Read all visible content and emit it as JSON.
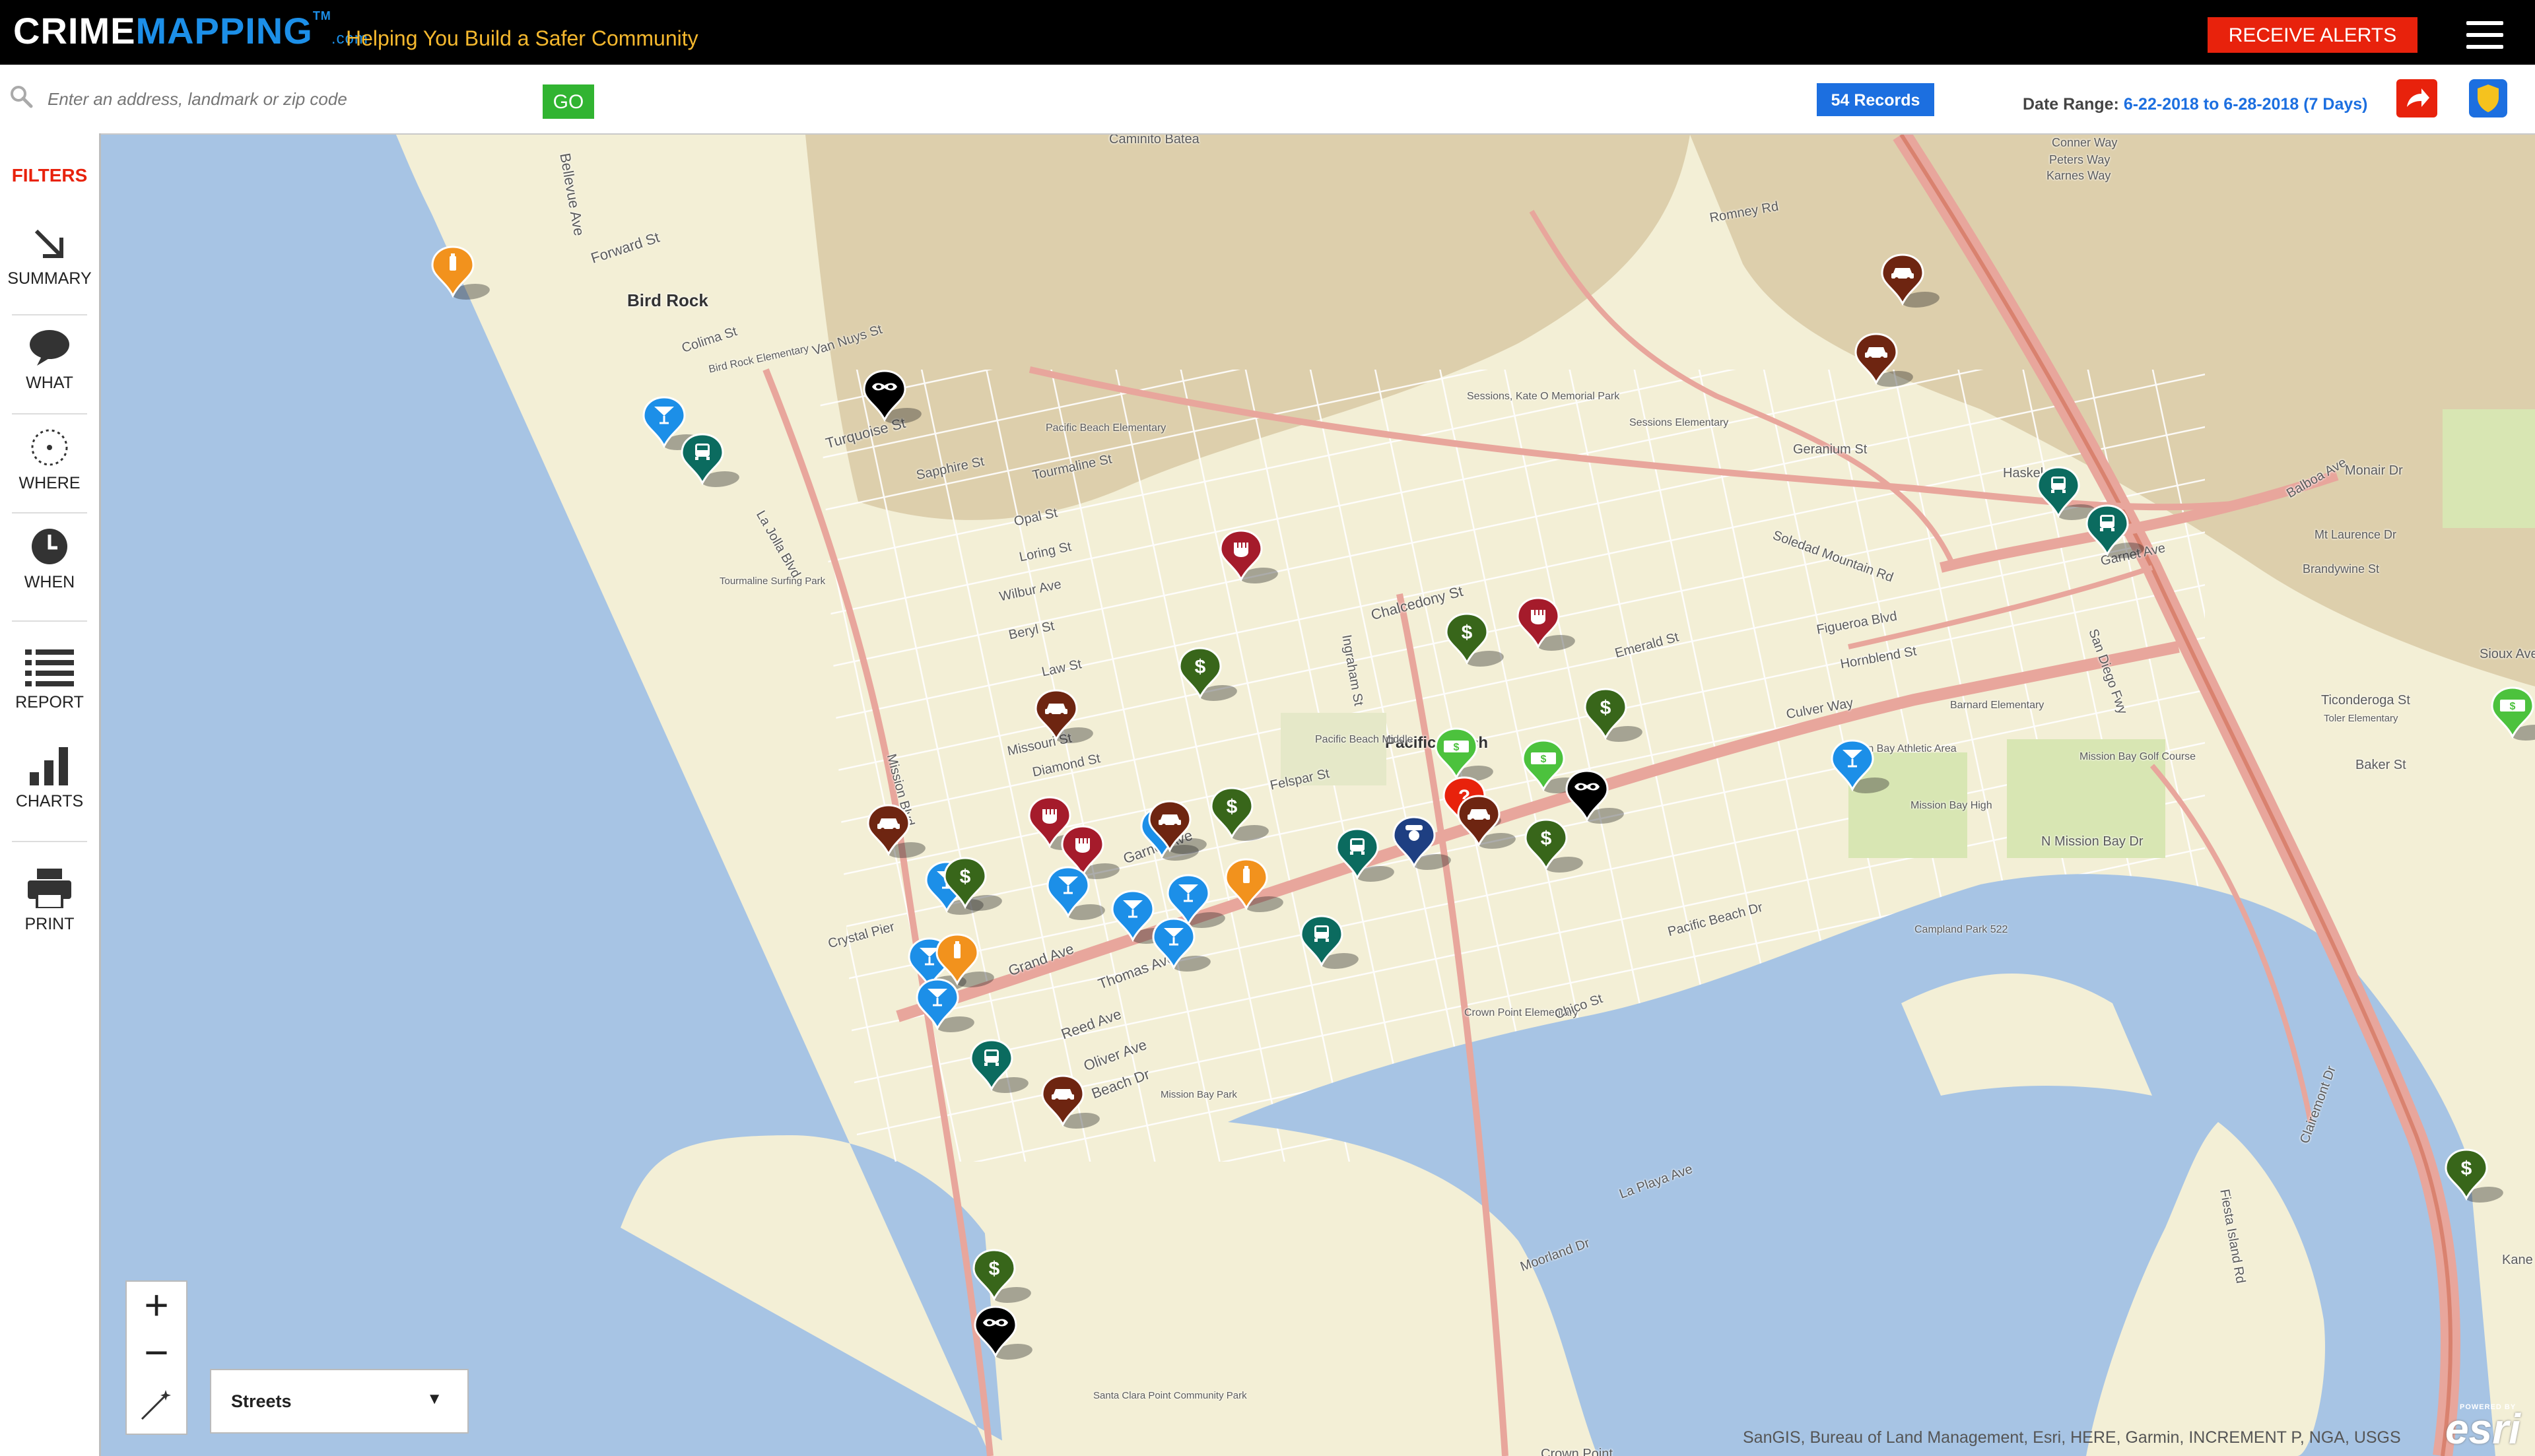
{
  "header": {
    "logo_crime": "CRIME",
    "logo_mapping": "MAPPING",
    "logo_tm": "TM",
    "logo_com": ".com",
    "tagline": "Helping You Build a Safer Community",
    "alerts_label": "RECEIVE ALERTS"
  },
  "search": {
    "placeholder": "Enter an address, landmark or zip code",
    "go_label": "GO",
    "records_label": "54 Records",
    "date_range_label": "Date Range:",
    "date_range_value": "6-22-2018 to 6-28-2018 (7 Days)"
  },
  "sidebar": {
    "filters_label": "FILTERS",
    "items": [
      {
        "label": "SUMMARY",
        "icon": "arrow-down-right-icon"
      },
      {
        "label": "WHAT",
        "icon": "speech-bubble-icon"
      },
      {
        "label": "WHERE",
        "icon": "target-icon"
      },
      {
        "label": "WHEN",
        "icon": "clock-icon"
      },
      {
        "label": "REPORT",
        "icon": "list-icon"
      },
      {
        "label": "CHARTS",
        "icon": "bar-chart-icon"
      },
      {
        "label": "PRINT",
        "icon": "printer-icon"
      }
    ]
  },
  "map": {
    "basemap_label": "Streets",
    "attribution": "SanGIS, Bureau of Land Management, Esri, HERE, Garmin, INCREMENT P, NGA, USGS",
    "esri_label": "esri",
    "powered_by": "POWERED BY",
    "colors": {
      "water": "#a7c4e4",
      "land": "#f3efd6",
      "hills": "#d8c9a4",
      "road_major": "#e8a69c",
      "road_minor": "#ffffff",
      "park": "#d8e6b3"
    },
    "place_labels": [
      {
        "text": "Caminito Batea"
      },
      {
        "text": "Bellevue Ave"
      },
      {
        "text": "Forward St"
      },
      {
        "text": "Bird Rock"
      },
      {
        "text": "Colima St"
      },
      {
        "text": "Bird Rock Elementary"
      },
      {
        "text": "Van Nuys St"
      },
      {
        "text": "Turquoise St"
      },
      {
        "text": "Sapphire St"
      },
      {
        "text": "Tourmaline St"
      },
      {
        "text": "Opal St"
      },
      {
        "text": "Loring St"
      },
      {
        "text": "Wilbur Ave"
      },
      {
        "text": "Beryl St"
      },
      {
        "text": "Law St"
      },
      {
        "text": "Chalcedony St"
      },
      {
        "text": "Missouri St"
      },
      {
        "text": "Diamond St"
      },
      {
        "text": "Felspar St"
      },
      {
        "text": "Garnet Ave"
      },
      {
        "text": "Grand Ave"
      },
      {
        "text": "Thomas Ave"
      },
      {
        "text": "Reed Ave"
      },
      {
        "text": "Oliver Ave"
      },
      {
        "text": "Beach Dr"
      },
      {
        "text": "Crystal Pier"
      },
      {
        "text": "Pacific Beach"
      },
      {
        "text": "Pacific Beach Middle"
      },
      {
        "text": "Pacific Beach Elementary"
      },
      {
        "text": "Sessions, Kate O Memorial Park"
      },
      {
        "text": "Sessions Elementary"
      },
      {
        "text": "Tourmaline Surfing Park"
      },
      {
        "text": "Mission Blvd"
      },
      {
        "text": "La Jolla Blvd"
      },
      {
        "text": "Ingraham St"
      },
      {
        "text": "Soledad Mountain Rd"
      },
      {
        "text": "Mission Bay High"
      },
      {
        "text": "Mission Bay Athletic Area"
      },
      {
        "text": "Mission Bay Golf Course"
      },
      {
        "text": "Campland Park 522"
      },
      {
        "text": "Crown Point Elementary"
      },
      {
        "text": "Chico St"
      },
      {
        "text": "La Playa Ave"
      },
      {
        "text": "Moorland Dr"
      },
      {
        "text": "Santa Clara Point Community Park"
      },
      {
        "text": "Mission Bay Park"
      },
      {
        "text": "N Mission Bay Dr"
      },
      {
        "text": "Fiesta Island Rd"
      },
      {
        "text": "San Diego Fwy"
      },
      {
        "text": "Balboa Ave"
      },
      {
        "text": "Clairemont Dr"
      },
      {
        "text": "Garnet Ave"
      },
      {
        "text": "Mt Laurence Dr"
      },
      {
        "text": "Brandywine St"
      },
      {
        "text": "Ticonderoga St"
      },
      {
        "text": "Toler Elementary"
      },
      {
        "text": "Baker St"
      },
      {
        "text": "Sioux Ave"
      },
      {
        "text": "Monair Dr"
      },
      {
        "text": "Romney Rd"
      },
      {
        "text": "Conner Way"
      },
      {
        "text": "Peters Way"
      },
      {
        "text": "Karnes Way"
      },
      {
        "text": "Geranium St"
      },
      {
        "text": "Haskel"
      },
      {
        "text": "Kane St"
      },
      {
        "text": "Crown Point"
      },
      {
        "text": "Figueroa Blvd"
      },
      {
        "text": "Hornblend St"
      },
      {
        "text": "Barnard Elementary"
      },
      {
        "text": "Culver Way"
      },
      {
        "text": "Emerald St"
      },
      {
        "text": "Pacific Beach Dr"
      }
    ],
    "markers": [
      {
        "type": "shoplifting",
        "color": "#f2921d",
        "icon": "bottle-icon"
      },
      {
        "type": "dui",
        "color": "#1c8fe8",
        "icon": "martini-icon"
      },
      {
        "type": "vehicle-break-in",
        "color": "#0b6b5f",
        "icon": "car-front-icon"
      },
      {
        "type": "robbery",
        "color": "#000000",
        "icon": "mask-icon"
      },
      {
        "type": "assault",
        "color": "#a51b2b",
        "icon": "fist-icon"
      },
      {
        "type": "theft",
        "color": "#38661a",
        "icon": "dollar-icon"
      },
      {
        "type": "vehicle-theft",
        "color": "#6e2511",
        "icon": "car-icon"
      },
      {
        "type": "fraud",
        "color": "#4cc23d",
        "icon": "money-icon"
      },
      {
        "type": "other",
        "color": "#e8220c",
        "icon": "question-icon"
      },
      {
        "type": "police",
        "color": "#1e3f82",
        "icon": "officer-icon"
      }
    ]
  }
}
